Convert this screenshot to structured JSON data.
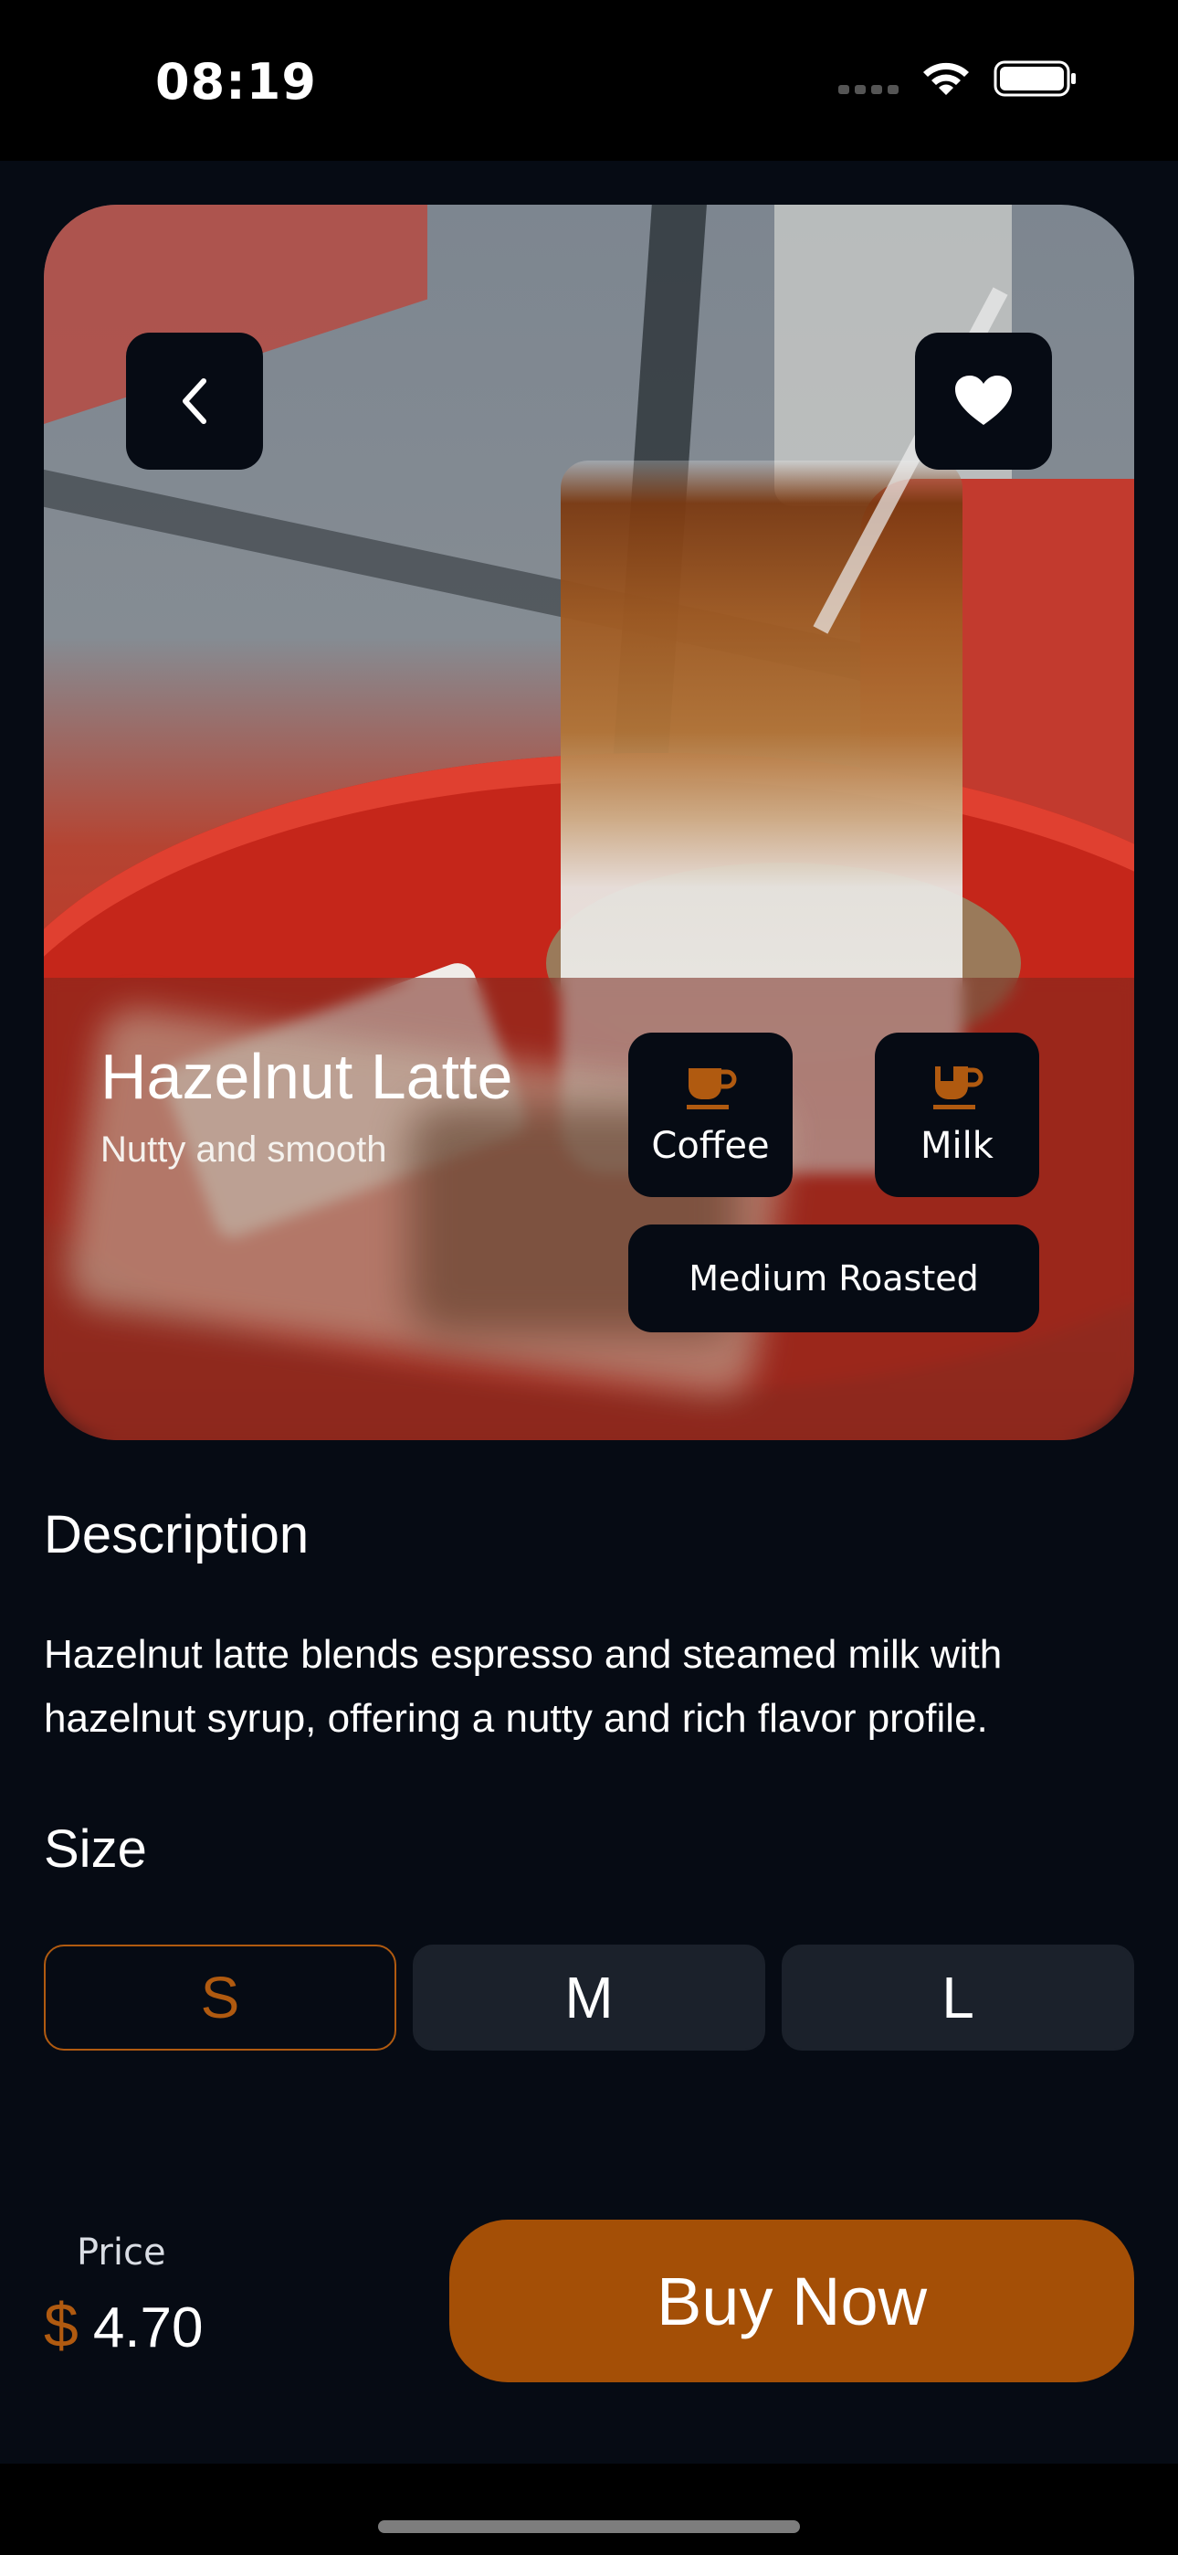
{
  "status_bar": {
    "time": "08:19"
  },
  "product": {
    "name": "Hazelnut Latte",
    "subtitle": "Nutty and smooth",
    "tags": [
      {
        "label": "Coffee",
        "icon": "coffee-cup-icon"
      },
      {
        "label": "Milk",
        "icon": "milk-cup-icon"
      }
    ],
    "roast": "Medium Roasted"
  },
  "description": {
    "title": "Description",
    "text": "Hazelnut latte blends espresso and steamed milk with hazelnut syrup, offering a nutty and rich flavor profile."
  },
  "size": {
    "title": "Size",
    "options": [
      "S",
      "M",
      "L"
    ],
    "selected": "S"
  },
  "price": {
    "label": "Price",
    "currency": "$",
    "value": "4.70"
  },
  "actions": {
    "buy_label": "Buy Now",
    "back_icon": "back-chevron-icon",
    "favorite_icon": "heart-icon"
  },
  "colors": {
    "accent": "#a44f06",
    "accent_text": "#b05a10",
    "background": "#060b14",
    "chip": "#1b212b"
  }
}
